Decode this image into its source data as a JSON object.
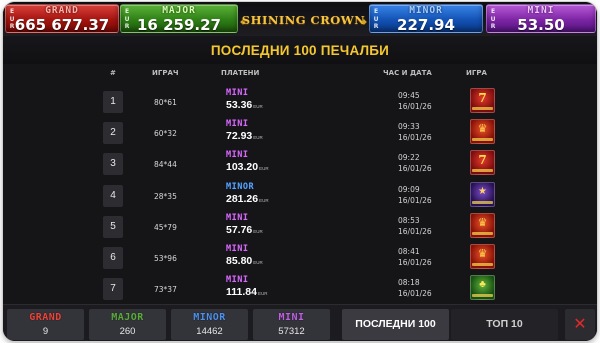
{
  "jackpots": {
    "grand": {
      "name": "GRAND",
      "value": "665 677.37",
      "currency": "EUR"
    },
    "major": {
      "name": "MAJOR",
      "value": "16 259.27",
      "currency": "EUR"
    },
    "minor": {
      "name": "MINOR",
      "value": "227.94",
      "currency": "EUR"
    },
    "mini": {
      "name": "MINI",
      "value": "53.50",
      "currency": "EUR"
    }
  },
  "logo": {
    "text": "SHINING CROWN"
  },
  "title": "ПОСЛЕДНИ 100 ПЕЧАЛБИ",
  "table": {
    "headers": {
      "num": "#",
      "player": "ИГРАЧ",
      "paid": "ПЛАТЕНИ",
      "time": "ЧАС И ДАТА",
      "game": "ИГРА"
    },
    "currency": "EUR",
    "rows": [
      {
        "rank": "1",
        "player": "80*61",
        "level": "MINI",
        "amount": "53.36",
        "time": "09:45",
        "date": "16/01/26",
        "game_icon": "red-seven-icon"
      },
      {
        "rank": "2",
        "player": "60*32",
        "level": "MINI",
        "amount": "72.93",
        "time": "09:33",
        "date": "16/01/26",
        "game_icon": "crown-icon"
      },
      {
        "rank": "3",
        "player": "84*44",
        "level": "MINI",
        "amount": "103.20",
        "time": "09:22",
        "date": "16/01/26",
        "game_icon": "red-seven-icon"
      },
      {
        "rank": "4",
        "player": "28*35",
        "level": "MINOR",
        "amount": "281.26",
        "time": "09:09",
        "date": "16/01/26",
        "game_icon": "purple-slot-icon"
      },
      {
        "rank": "5",
        "player": "45*79",
        "level": "MINI",
        "amount": "57.76",
        "time": "08:53",
        "date": "16/01/26",
        "game_icon": "crown-icon"
      },
      {
        "rank": "6",
        "player": "53*96",
        "level": "MINI",
        "amount": "85.80",
        "time": "08:41",
        "date": "16/01/26",
        "game_icon": "crown-icon"
      },
      {
        "rank": "7",
        "player": "73*37",
        "level": "MINI",
        "amount": "111.84",
        "time": "08:18",
        "date": "16/01/26",
        "game_icon": "green-slot-icon"
      }
    ]
  },
  "bottom": {
    "grand": {
      "name": "GRAND",
      "count": "9"
    },
    "major": {
      "name": "MAJOR",
      "count": "260"
    },
    "minor": {
      "name": "MINOR",
      "count": "14462"
    },
    "mini": {
      "name": "MINI",
      "count": "57312"
    },
    "tab_last100": "ПОСЛЕДНИ 100",
    "tab_top10": "ТОП 10",
    "close_symbol": "✕"
  },
  "colors": {
    "grand": "#c8221b",
    "major": "#3f9a24",
    "minor": "#2f72db",
    "mini": "#9a3cc6",
    "title": "#f6c82f",
    "close": "#e02a2a"
  }
}
